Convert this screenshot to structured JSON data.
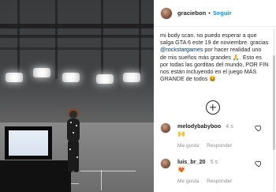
{
  "post": {
    "username": "graciebon",
    "separator": "•",
    "follow_label": "Seguir",
    "caption": {
      "prefix": "mi body scan. no puedo esperar a que salga GTA 6 este 19 de noviembre. gracias ",
      "mention": "@rockstargames",
      "suffix": " por hacer realidad uno de mis sueños más grandes 🙏. Esto es por todas las gorditas del mundo, POR FIN nos están incluyendo en el juego MÁS GRANDE de todos 😆"
    }
  },
  "comments": [
    {
      "username": "melodybabyboo",
      "time": "4 s",
      "text": "🙌",
      "like_label": "Me gusta",
      "reply_label": "Responder"
    },
    {
      "username": "luis_br_20",
      "time": "5 s",
      "text": "😻",
      "like_label": "Me gusta",
      "reply_label": "Responder"
    }
  ],
  "icons": {
    "load_more": "plus-circle-icon",
    "heart": "heart-icon"
  },
  "colors": {
    "follow_blue": "#0095f6",
    "mention_blue": "#00376b",
    "muted_text": "#8e8e8e"
  }
}
